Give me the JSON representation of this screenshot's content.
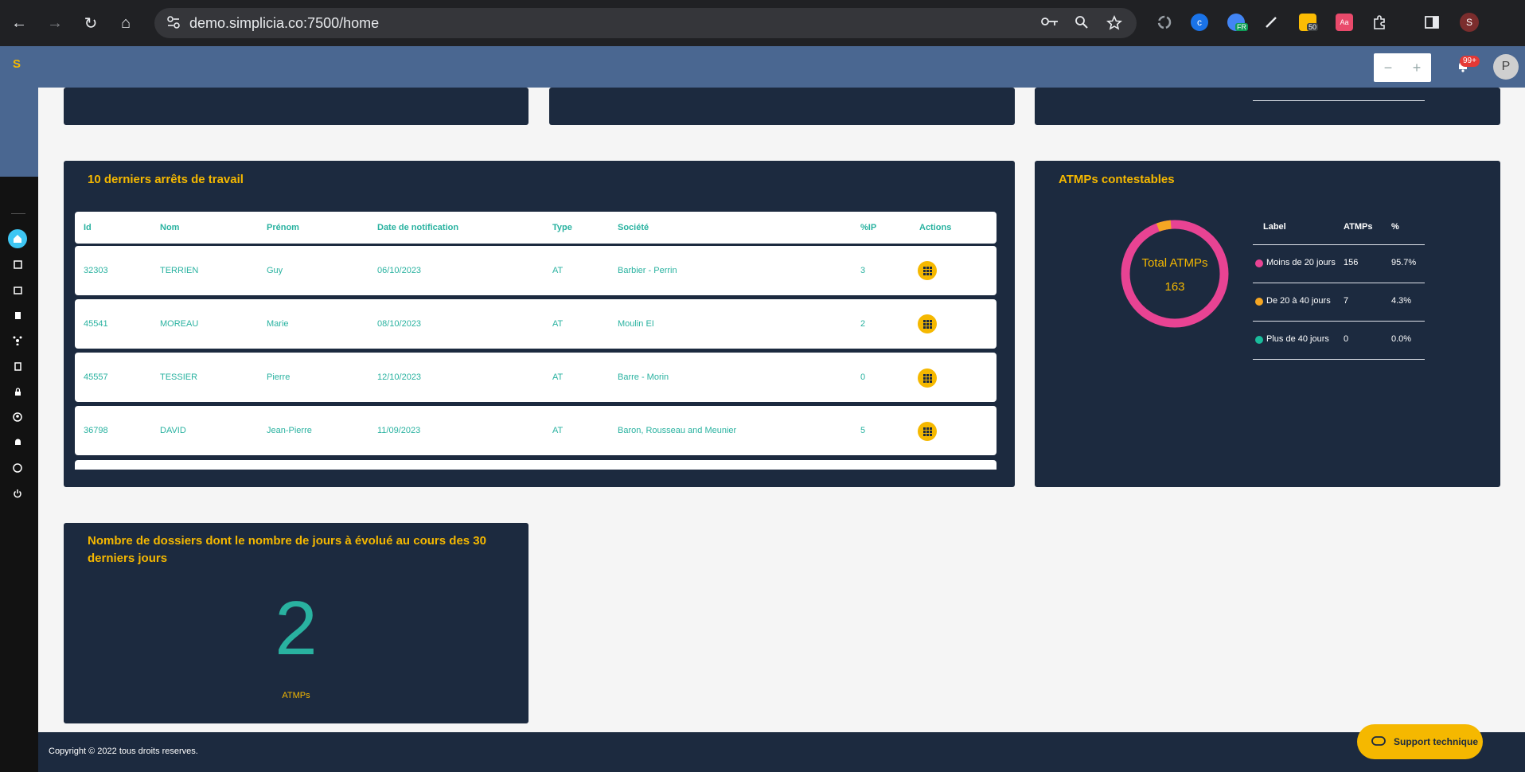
{
  "browser": {
    "url": "demo.simplicia.co:7500/home",
    "back_icon": "←",
    "forward_icon": "→",
    "reload_icon": "↻",
    "home_icon": "⌂",
    "ext_translate_badge": "FR",
    "ext_notes_badge": "50",
    "ext_dict_label": "Aa",
    "profile_initial": "S"
  },
  "app": {
    "logo": "S",
    "zoom_minus": "−",
    "zoom_plus": "+",
    "notif_count": "99+",
    "avatar_initial": "P",
    "accent_color": "#f5b800",
    "panel_color": "#1c2a3f"
  },
  "sidebar": {
    "icons": [
      "home-icon",
      "documents-icon",
      "calendar-icon",
      "clipboard-icon",
      "network-icon",
      "file-icon",
      "lock-icon",
      "user-circle-icon",
      "bell-icon",
      "help-icon",
      "power-icon"
    ]
  },
  "last_stops": {
    "title": "10 derniers arrêts de travail",
    "columns": [
      "Id",
      "Nom",
      "Prénom",
      "Date de notification",
      "Type",
      "Société",
      "%IP",
      "Actions"
    ],
    "rows": [
      {
        "id": "32303",
        "nom": "TERRIEN",
        "prenom": "Guy",
        "date": "06/10/2023",
        "type": "AT",
        "societe": "Barbier - Perrin",
        "ip": "3"
      },
      {
        "id": "45541",
        "nom": "MOREAU",
        "prenom": "Marie",
        "date": "08/10/2023",
        "type": "AT",
        "societe": "Moulin EI",
        "ip": "2"
      },
      {
        "id": "45557",
        "nom": "TESSIER",
        "prenom": "Pierre",
        "date": "12/10/2023",
        "type": "AT",
        "societe": "Barre - Morin",
        "ip": "0"
      },
      {
        "id": "36798",
        "nom": "DAVID",
        "prenom": "Jean-Pierre",
        "date": "11/09/2023",
        "type": "AT",
        "societe": "Baron, Rousseau and Meunier",
        "ip": "5"
      }
    ]
  },
  "atmps": {
    "title": "ATMPs contestables",
    "center_label": "Total ATMPs",
    "center_value": "163",
    "legend_headers": [
      "Label",
      "ATMPs",
      "%"
    ],
    "legend": [
      {
        "label": "Moins de 20 jours",
        "count": "156",
        "pct": "95.7%",
        "color": "#e84393"
      },
      {
        "label": "De 20 à 40 jours",
        "count": "7",
        "pct": "4.3%",
        "color": "#f5a623"
      },
      {
        "label": "Plus de 40 jours",
        "count": "0",
        "pct": "0.0%",
        "color": "#1abc9c"
      }
    ]
  },
  "evolved": {
    "title": "Nombre de dossiers dont le nombre de jours à évolué au cours des 30 derniers jours",
    "value": "2",
    "unit": "ATMPs"
  },
  "footer": {
    "copyright": "Copyright © 2022 tous droits reserves.",
    "support_label": "Support technique"
  }
}
